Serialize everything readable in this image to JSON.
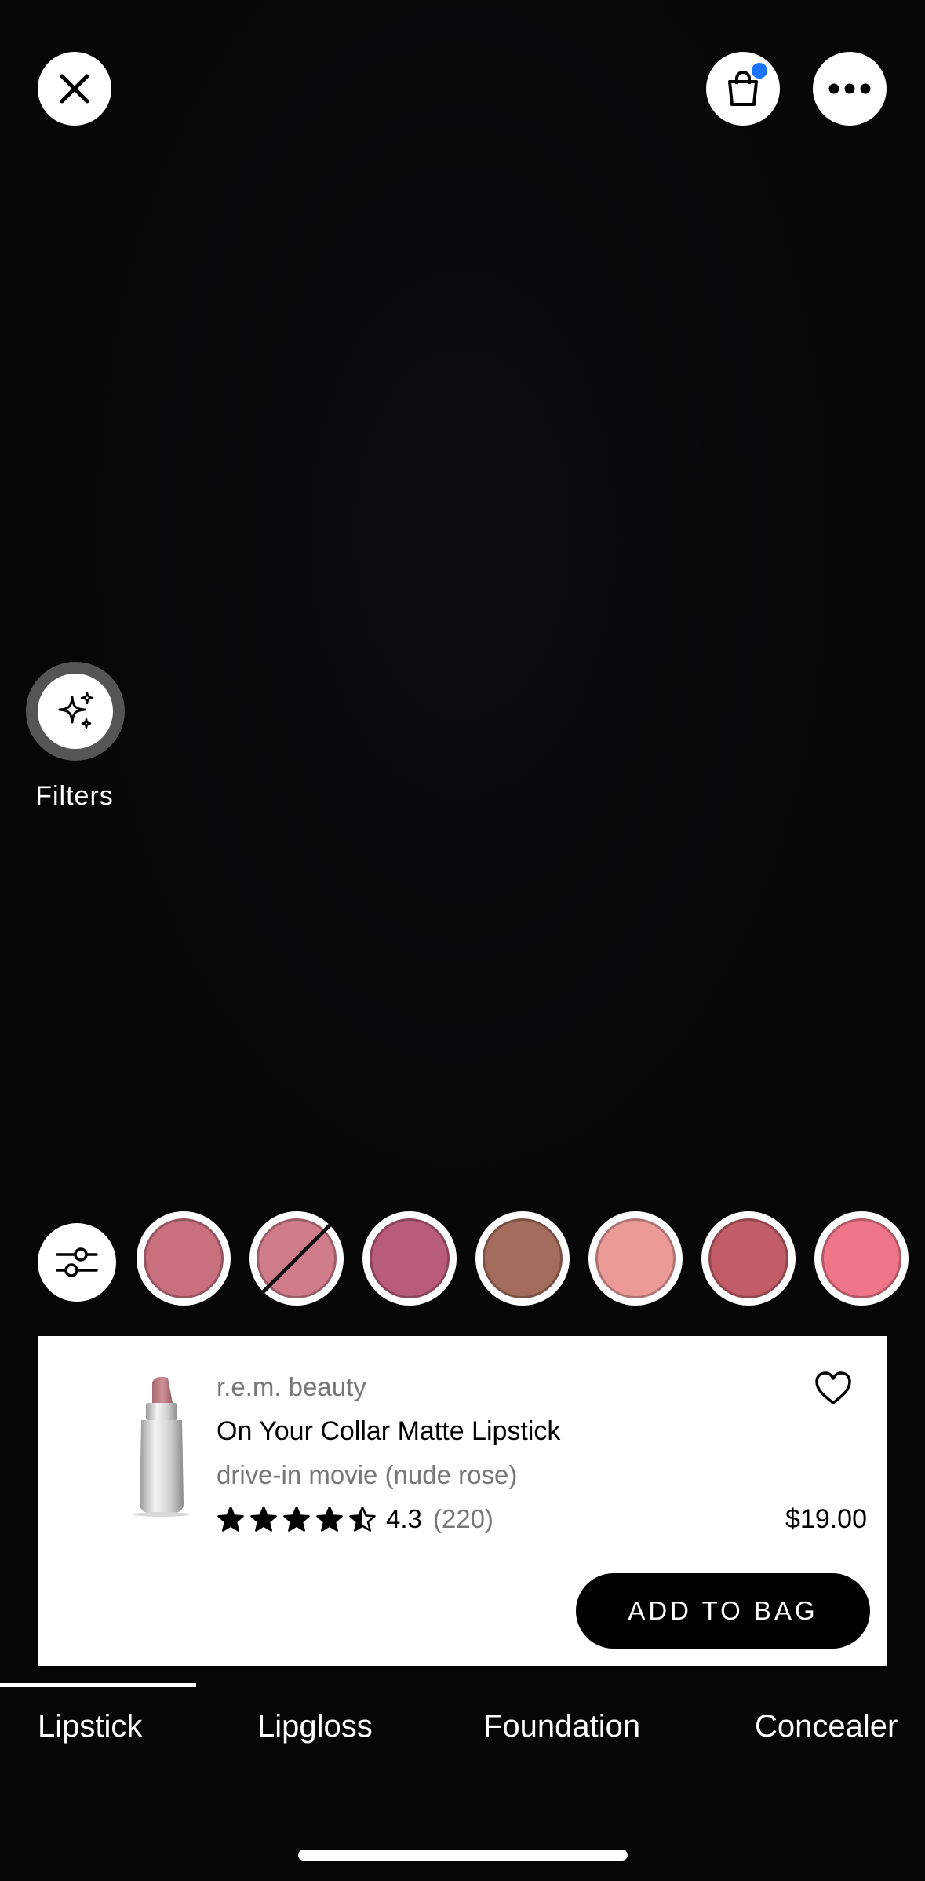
{
  "topbar": {
    "close_icon": "close-icon",
    "bag_icon": "shopping-bag-icon",
    "bag_badge_color": "#1a73ff",
    "more_icon": "more-horizontal-icon"
  },
  "filters": {
    "label": "Filters",
    "icon": "sparkles-icon"
  },
  "swatches": [
    {
      "color": "#c9707f",
      "selected": false,
      "slashed": false
    },
    {
      "color": "#d07c8a",
      "selected": true,
      "slashed": true
    },
    {
      "color": "#b95c7a",
      "selected": false,
      "slashed": false
    },
    {
      "color": "#a46c5c",
      "selected": false,
      "slashed": false
    },
    {
      "color": "#eb9a98",
      "selected": false,
      "slashed": false
    },
    {
      "color": "#c25c66",
      "selected": false,
      "slashed": false
    },
    {
      "color": "#ee7688",
      "selected": false,
      "slashed": false
    }
  ],
  "product": {
    "brand": "r.e.m. beauty",
    "name": "On Your Collar Matte Lipstick",
    "shade": "drive-in movie (nude rose)",
    "rating": "4.3",
    "rating_value": 4.5,
    "review_count": "(220)",
    "price": "$19.00",
    "add_to_bag_label": "ADD TO BAG"
  },
  "tabs": [
    {
      "label": "Lipstick",
      "active": true
    },
    {
      "label": "Lipgloss",
      "active": false
    },
    {
      "label": "Foundation",
      "active": false
    },
    {
      "label": "Concealer",
      "active": false
    }
  ]
}
